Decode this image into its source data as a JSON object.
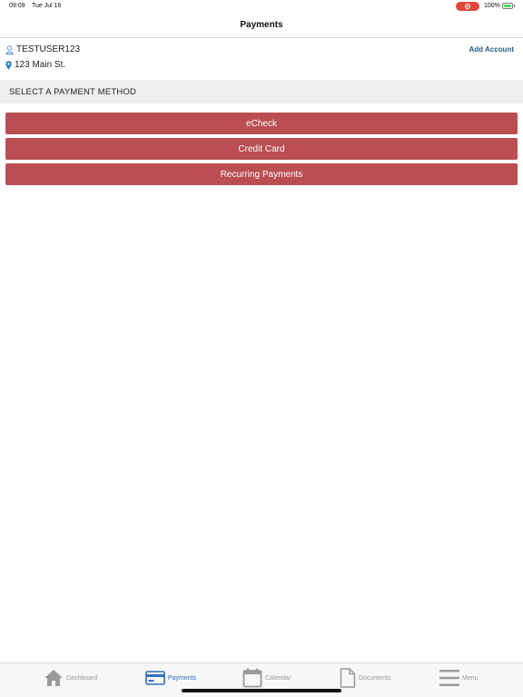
{
  "status_bar": {
    "time": "09:09",
    "date": "Tue Jul 16",
    "battery_percent": "100%"
  },
  "nav": {
    "title": "Payments"
  },
  "account": {
    "user_name": "TESTUSER123",
    "address": "123 Main St.",
    "add_account_label": "Add Account"
  },
  "section": {
    "header": "SELECT A PAYMENT METHOD"
  },
  "payment_methods": [
    {
      "label": "eCheck"
    },
    {
      "label": "Credit Card"
    },
    {
      "label": "Recurring Payments"
    }
  ],
  "tab_bar": {
    "items": [
      {
        "label": "Dashboard",
        "icon": "home-icon",
        "active": false
      },
      {
        "label": "Payments",
        "icon": "credit-card-icon",
        "active": true
      },
      {
        "label": "Calendar",
        "icon": "calendar-icon",
        "active": false
      },
      {
        "label": "Documents",
        "icon": "document-icon",
        "active": false
      },
      {
        "label": "Menu",
        "icon": "menu-icon",
        "active": false
      }
    ]
  },
  "colors": {
    "button": "#bb4e52",
    "accent_active": "#2e6fbe",
    "link": "#1f5d86",
    "section_bg": "#efefef"
  }
}
